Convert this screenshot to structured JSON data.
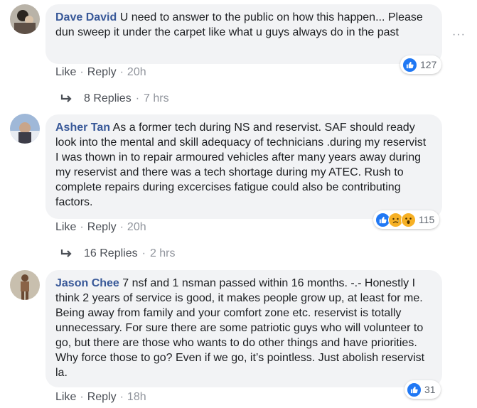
{
  "comments": [
    {
      "author": "Dave David",
      "text": "U need to answer to the public on how this happen... Please dun sweep it under the carpet like what u guys always do in the past",
      "reaction_count": "127",
      "reaction_types": [
        "like"
      ],
      "actions": {
        "like": "Like",
        "reply": "Reply",
        "time": "20h"
      },
      "replies": {
        "label": "8 Replies",
        "time": "7 hrs"
      }
    },
    {
      "author": "Asher Tan",
      "text": "As a former tech during NS and reservist. SAF should ready look into the mental and skill adequacy of technicians .during my reservist I was thown in to repair armoured vehicles after many years away during my reservist and there was a tech shortage during my ATEC. Rush to complete repairs during excercises fatigue could also be contributing factors.",
      "reaction_count": "115",
      "reaction_types": [
        "like",
        "sad",
        "wow"
      ],
      "actions": {
        "like": "Like",
        "reply": "Reply",
        "time": "20h"
      },
      "replies": {
        "label": "16 Replies",
        "time": "2 hrs"
      }
    },
    {
      "author": "Jason Chee",
      "text": "7 nsf and 1 nsman passed within 16 months. -.- Honestly I think 2 years of service is good, it makes people grow up, at least for me. Being away from family and your comfort zone etc. reservist is totally unnecessary. For sure there are some patriotic guys who will volunteer to go, but there are those who wants to do other things and have priorities. Why force those to go? Even if we go, it’s pointless. Just abolish reservist la.",
      "reaction_count": "31",
      "reaction_types": [
        "like"
      ],
      "actions": {
        "like": "Like",
        "reply": "Reply",
        "time": "18h"
      }
    }
  ],
  "more_options": "···",
  "separator": "·",
  "colors": {
    "link": "#385898",
    "bubble": "#f2f3f5",
    "like_blue": "#2078f4",
    "meta": "#90949c"
  }
}
